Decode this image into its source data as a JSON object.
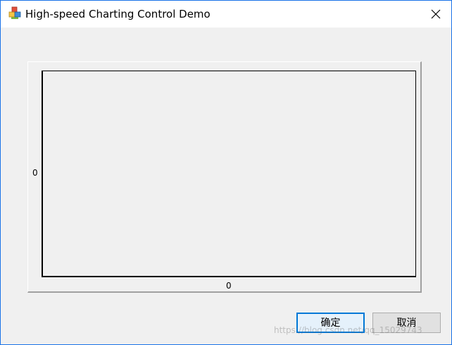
{
  "window": {
    "title": "High-speed Charting Control Demo"
  },
  "titlebar_icons": {
    "app_icon": "application-icon",
    "close_icon": "close-icon"
  },
  "chart": {
    "y_axis_value": "0",
    "x_axis_value": "0"
  },
  "buttons": {
    "ok_label": "确定",
    "cancel_label": "取消"
  },
  "watermark": {
    "text": "https://blog.csdn.net/qq_15029743"
  },
  "colors": {
    "window_border": "#1a73e8",
    "background": "#f0f0f0",
    "button_focus": "#0078d7"
  }
}
